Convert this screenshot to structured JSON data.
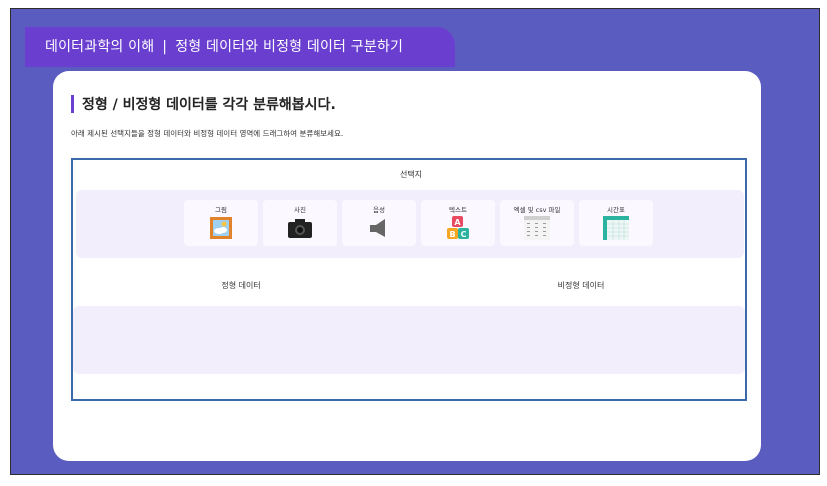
{
  "header": {
    "course": "데이터과학의 이해",
    "separator": "|",
    "lesson": "정형 데이터와 비정형 데이터 구분하기"
  },
  "main": {
    "title": "정형 / 비정형 데이터를 각각 분류해봅시다.",
    "instruction": "아래 제시된 선택지들을 정형 데이터와 비정형 데이터 영역에 드래그하여 분류해보세요.",
    "choices_label": "선택지",
    "choices": [
      {
        "label": "그림",
        "icon": "picture-icon"
      },
      {
        "label": "사진",
        "icon": "camera-icon"
      },
      {
        "label": "음성",
        "icon": "speaker-icon"
      },
      {
        "label": "텍스트",
        "icon": "abc-blocks-icon"
      },
      {
        "label": "엑셀 및 csv 파일",
        "icon": "spreadsheet-icon"
      },
      {
        "label": "시간표",
        "icon": "timetable-icon"
      }
    ],
    "structured_label": "정형 데이터",
    "unstructured_label": "비정형 데이터"
  },
  "colors": {
    "background": "#5b5cc0",
    "header_tab": "#6a3fd0",
    "box_border": "#3c6aa8",
    "zone_fill": "#f2eefb"
  }
}
